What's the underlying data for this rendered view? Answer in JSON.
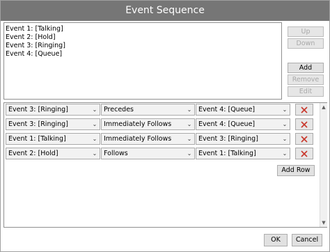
{
  "window": {
    "title": "Event Sequence"
  },
  "events_list": {
    "items": [
      "Event 1: [Talking]",
      "Event 2: [Hold]",
      "Event 3: [Ringing]",
      "Event 4: [Queue]"
    ]
  },
  "side_buttons": {
    "up": "Up",
    "down": "Down",
    "add": "Add",
    "remove": "Remove",
    "edit": "Edit"
  },
  "rules": [
    {
      "first": "Event 3: [Ringing]",
      "relation": "Precedes",
      "second": "Event 4: [Queue]"
    },
    {
      "first": "Event 3: [Ringing]",
      "relation": "Immediately Follows",
      "second": "Event 4: [Queue]"
    },
    {
      "first": "Event 1: [Talking]",
      "relation": "Immediately Follows",
      "second": "Event 3: [Ringing]"
    },
    {
      "first": "Event 2: [Hold]",
      "relation": "Follows",
      "second": "Event 1: [Talking]"
    }
  ],
  "add_row_label": "Add Row",
  "footer": {
    "ok": "OK",
    "cancel": "Cancel"
  },
  "icons": {
    "delete": "delete-x-icon",
    "dropdown": "chevron-down-icon",
    "scroll_up": "scroll-up-arrow-icon",
    "scroll_down": "scroll-down-arrow-icon"
  },
  "colors": {
    "titlebar": "#767676",
    "delete_icon": "#c9362b"
  }
}
